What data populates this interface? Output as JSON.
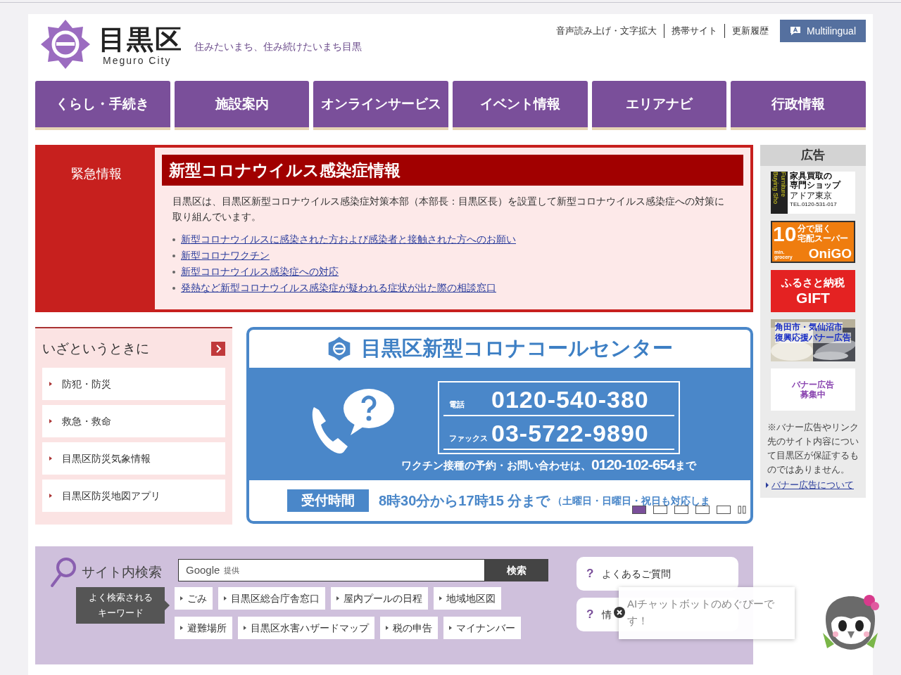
{
  "header": {
    "logo_name": "目黒区",
    "logo_sub": "Meguro City",
    "tagline": "住みたいまち、住み続けたいまち目黒",
    "links": [
      "音声読み上げ・文字拡大",
      "携帯サイト",
      "更新履歴"
    ],
    "multilingual": "Multilingual"
  },
  "nav": [
    "くらし・手続き",
    "施設案内",
    "オンラインサービス",
    "イベント情報",
    "エリアナビ",
    "行政情報"
  ],
  "emergency": {
    "label": "緊急情報",
    "title": "新型コロナウイルス感染症情報",
    "body": "目黒区は、目黒区新型コロナウイルス感染症対策本部（本部長：目黒区長）を設置して新型コロナウイルス感染症への対策に取り組んでいます。",
    "links": [
      "新型コロナウイルスに感染された方および感染者と接触された方へのお願い",
      "新型コロナワクチン",
      "新型コロナウイルス感染症への対応",
      "発熱など新型コロナウイルス感染症が疑われる症状が出た際の相談窓口"
    ]
  },
  "emergency_menu": {
    "title": "いざというときに",
    "items": [
      "防犯・防災",
      "救急・救命",
      "目黒区防災気象情報",
      "目黒区防災地図アプリ"
    ]
  },
  "banner": {
    "title": "目黒区新型コロナコールセンター",
    "phone_label": "電話",
    "phone": "0120-540-380",
    "fax_label": "ファックス",
    "fax": "03-5722-9890",
    "vaccine_text": "ワクチン接種の予約・お問い合わせは、",
    "vaccine_number": "0120-102-654",
    "vaccine_suffix": "まで",
    "hours_label": "受付時間",
    "hours": "8時30分から17時15 分まで",
    "hours_note": "（土曜日・日曜日・祝日も対応しま",
    "slides": [
      {
        "selected": true
      },
      {
        "selected": false
      },
      {
        "selected": false
      },
      {
        "selected": false
      },
      {
        "selected": false
      }
    ]
  },
  "ads": {
    "title": "広告",
    "banners": [
      {
        "kind": "furniture",
        "lines": [
          "Furniture",
          "Buying Sho",
          "家具買取の",
          "専門ショップ",
          "アドア東京",
          "TEL.0120-531-017"
        ]
      },
      {
        "kind": "grocery",
        "lines": [
          "10",
          "分で届く",
          "宅配スーパー",
          "min. grocery",
          "OniGO"
        ]
      },
      {
        "kind": "gift",
        "lines": [
          "ふるさと納税",
          "GIFT"
        ]
      },
      {
        "lines": [
          "角田市・気仙沼市",
          "復興応援バナー広告"
        ]
      },
      {
        "kind": "recruit",
        "lines": [
          "バナー広告",
          "募集中"
        ]
      }
    ],
    "note": "※バナー広告やリンク先のサイト内容について目黒区が保証するものではありません。",
    "link": "バナー広告について"
  },
  "search": {
    "title": "サイト内検索",
    "placeholder_brand": "Google",
    "placeholder": "提供",
    "button": "検索",
    "keywords_label": [
      "よく検索される",
      "キーワード"
    ],
    "keywords": [
      "ごみ",
      "目黒区総合庁舎窓口",
      "屋内プールの日程",
      "地域地区図",
      "避難場所",
      "目黒区水害ハザードマップ",
      "税の申告",
      "マイナンバー"
    ]
  },
  "faq": [
    {
      "icon": "?",
      "label": "よくあるご質問"
    },
    {
      "icon": "?",
      "label": "情"
    }
  ],
  "chatbot": {
    "message": "AIチャットボットのめぐぴーです！"
  }
}
